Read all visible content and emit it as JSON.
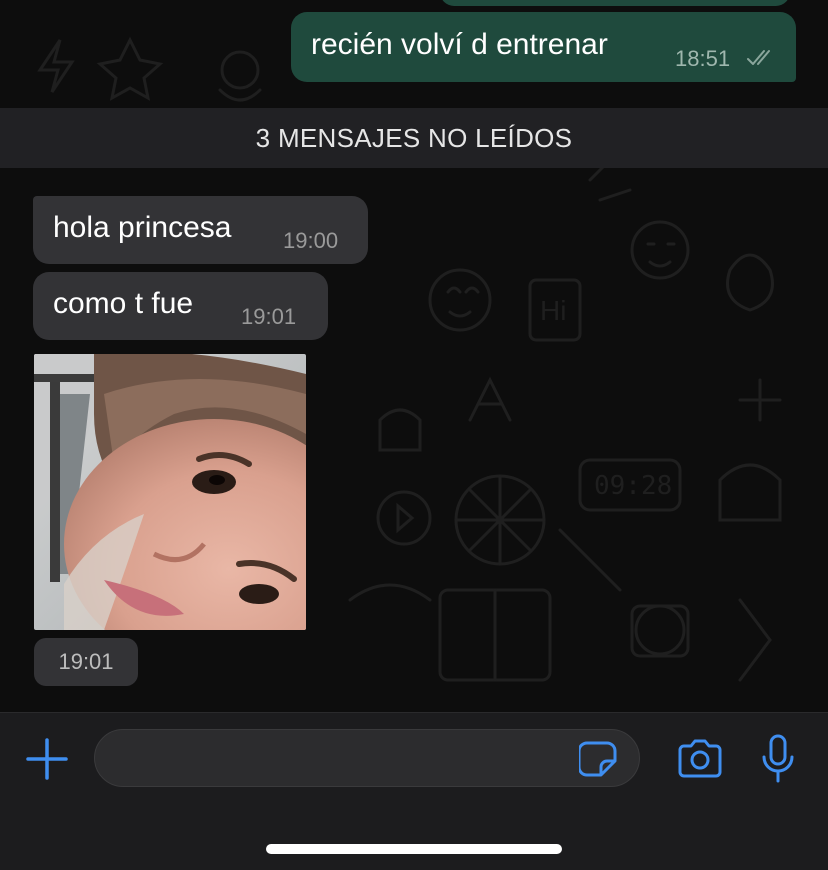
{
  "chat": {
    "outgoing": [
      {
        "text": "recién volví d entrenar",
        "time": "18:51",
        "status": "read-double-check"
      }
    ],
    "unread_divider": "3 MENSAJES NO LEÍDOS",
    "incoming": [
      {
        "text": "hola princesa",
        "time": "19:00"
      },
      {
        "text": "como t fue",
        "time": "19:01"
      }
    ],
    "photo_message": {
      "time": "19:01"
    }
  },
  "composer": {
    "placeholder": "",
    "icons": [
      "plus-icon",
      "sticker-icon",
      "camera-icon",
      "microphone-icon"
    ]
  },
  "colors": {
    "accent": "#3f8ef0",
    "outgoing_bubble": "#1f4a3d",
    "incoming_bubble": "#333336",
    "background": "#0d0d0d"
  }
}
